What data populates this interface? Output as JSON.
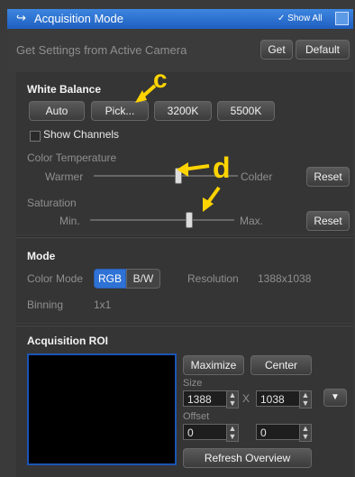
{
  "titlebar": {
    "title": "Acquisition Mode",
    "show_all": "✓ Show All"
  },
  "top": {
    "label": "Get Settings from Active Camera",
    "get": "Get",
    "default": "Default"
  },
  "white_balance": {
    "heading": "White Balance",
    "buttons": {
      "auto": "Auto",
      "pick": "Pick...",
      "k3200": "3200K",
      "k5500": "5500K"
    },
    "show_channels": "Show Channels",
    "color_temp_label": "Color Temperature",
    "warmer": "Warmer",
    "colder": "Colder",
    "reset1": "Reset",
    "saturation_label": "Saturation",
    "min": "Min.",
    "max": "Max.",
    "reset2": "Reset",
    "color_temperature_level": 0.58,
    "saturation_level": 0.68
  },
  "mode": {
    "heading": "Mode",
    "color_mode_label": "Color Mode",
    "rgb": "RGB",
    "bw": "B/W",
    "resolution_label": "Resolution",
    "resolution_value": "1388x1038",
    "binning_label": "Binning",
    "binning_value": "1x1"
  },
  "roi": {
    "heading": "Acquisition ROI",
    "maximize": "Maximize",
    "center": "Center",
    "size_label": "Size",
    "size_w": "1388",
    "x": "X",
    "size_h": "1038",
    "offset_label": "Offset",
    "offset_x": "0",
    "offset_y": "0",
    "refresh": "Refresh Overview"
  },
  "annotations": {
    "c": "c",
    "d": "d"
  },
  "colors": {
    "accent": "#2f72d6",
    "annotation": "#ffd400"
  }
}
